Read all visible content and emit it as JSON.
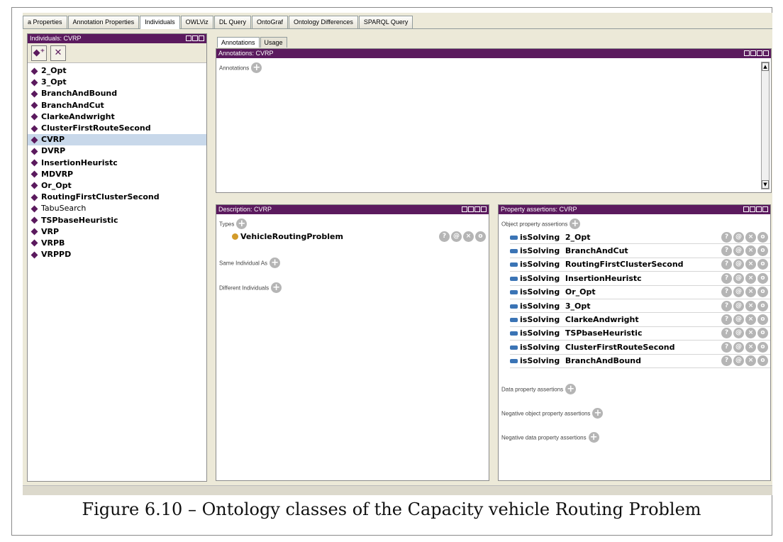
{
  "tabs": [
    "a Properties",
    "Annotation Properties",
    "Individuals",
    "OWLViz",
    "DL Query",
    "OntoGraf",
    "Ontology Differences",
    "SPARQL Query"
  ],
  "individuals_panel": {
    "title": "Individuals: CVRP",
    "add_icon": "add-individual-icon",
    "delete_icon": "delete-individual-icon",
    "items": [
      "2_Opt",
      "3_Opt",
      "BranchAndBound",
      "BranchAndCut",
      "ClarkeAndwright",
      "ClusterFirstRouteSecond",
      "CVRP",
      "DVRP",
      "InsertionHeuristc",
      "MDVRP",
      "Or_Opt",
      "RoutingFirstClusterSecond",
      "TabuSearch",
      "TSPbaseHeuristic",
      "VRP",
      "VRPB",
      "VRPPD"
    ]
  },
  "subtabs": [
    "Annotations",
    "Usage"
  ],
  "annotations_panel": {
    "title": "Annotations: CVRP",
    "label": "Annotations"
  },
  "description_panel": {
    "title": "Description: CVRP",
    "types_label": "Types",
    "type_value": "VehicleRoutingProblem",
    "same_label": "Same Individual As",
    "different_label": "Different Individuals"
  },
  "property_panel": {
    "title": "Property assertions: CVRP",
    "object_label": "Object property assertions",
    "property": "isSolving",
    "assertions": [
      "2_Opt",
      "BranchAndCut",
      "RoutingFirstClusterSecond",
      "InsertionHeuristc",
      "Or_Opt",
      "3_Opt",
      "ClarkeAndwright",
      "TSPbaseHeuristic",
      "ClusterFirstRouteSecond",
      "BranchAndBound"
    ],
    "data_label": "Data property assertions",
    "neg_object_label": "Negative object property assertions",
    "neg_data_label": "Negative data property assertions"
  },
  "row_controls": [
    "?",
    "@",
    "×",
    "o"
  ],
  "caption": "Figure 6.10 – Ontology classes of the Capacity vehicle Routing Problem",
  "colors": {
    "title_bar": "#5b1a5e",
    "selection": "#c8d8ea",
    "assertion_bar": "#3b74b5"
  }
}
